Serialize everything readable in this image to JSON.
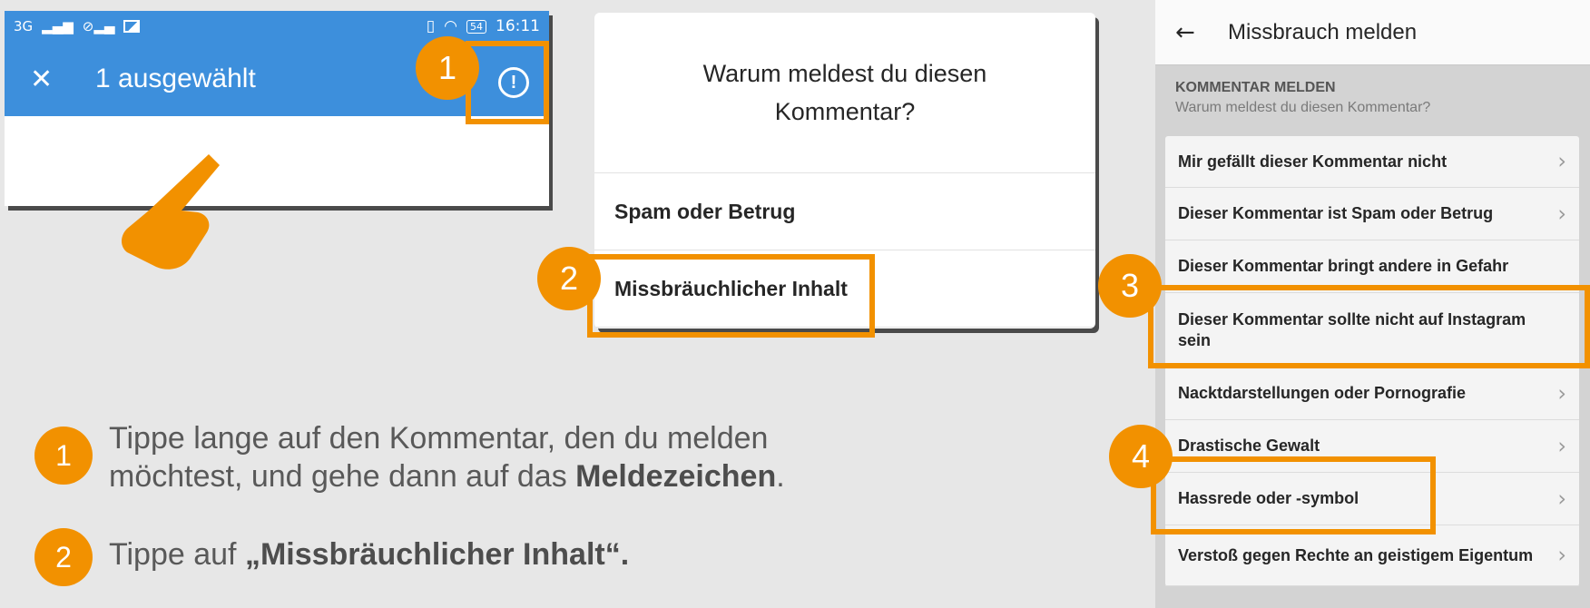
{
  "panel1": {
    "status": {
      "network": "3G",
      "time": "16:11",
      "battery": "54"
    },
    "appbar": {
      "close": "✕",
      "title": "1 ausgewählt",
      "alert": "!"
    }
  },
  "panel2": {
    "question": "Warum meldest du diesen Kommentar?",
    "options": [
      "Spam oder Betrug",
      "Missbräuchlicher Inhalt"
    ]
  },
  "panel3": {
    "header": "Missbrauch melden",
    "section_title": "KOMMENTAR MELDEN",
    "section_subtitle": "Warum meldest du diesen Kommentar?",
    "items": [
      "Mir gefällt dieser Kommentar nicht",
      "Dieser Kommentar ist Spam oder Betrug",
      "Dieser Kommentar bringt andere in Gefahr",
      "Dieser Kommentar sollte nicht auf Instagram sein",
      "Nacktdarstellungen oder Pornografie",
      "Drastische Gewalt",
      "Hassrede oder -symbol",
      "Verstoß gegen Rechte an geistigem Eigentum"
    ]
  },
  "steps": [
    "1",
    "2",
    "3",
    "4"
  ],
  "instructions": {
    "one_a": "Tippe lange auf den Kommentar, den du melden",
    "one_b": "möchtest, und gehe dann auf das ",
    "one_bold": "Meldezeichen",
    "one_end": ".",
    "two_a": "Tippe auf ",
    "two_bold": "„Missbräuchlicher Inhalt“."
  },
  "colors": {
    "accent": "#f29100",
    "appbar": "#3d8fdc"
  }
}
